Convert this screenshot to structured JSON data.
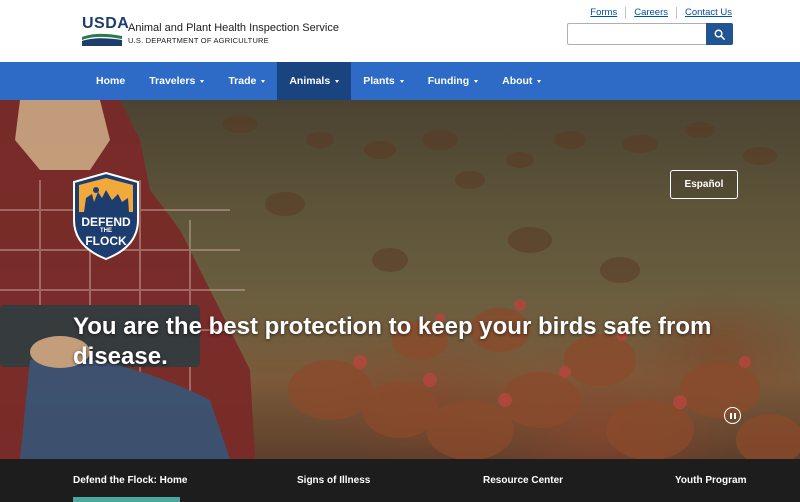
{
  "header": {
    "logo_text": "USDA",
    "agency_name": "Animal and Plant Health Inspection Service",
    "department": "U.S. DEPARTMENT OF AGRICULTURE",
    "utility_links": [
      "Forms",
      "Careers",
      "Contact Us"
    ],
    "search": {
      "placeholder": "",
      "value": "",
      "button_icon": "search-icon"
    }
  },
  "nav": {
    "items": [
      {
        "label": "Home",
        "dropdown": false
      },
      {
        "label": "Travelers",
        "dropdown": true
      },
      {
        "label": "Trade",
        "dropdown": true
      },
      {
        "label": "Animals",
        "dropdown": true,
        "active": true
      },
      {
        "label": "Plants",
        "dropdown": true
      },
      {
        "label": "Funding",
        "dropdown": true
      },
      {
        "label": "About",
        "dropdown": true
      }
    ]
  },
  "hero": {
    "badge_line1": "DEFEND",
    "badge_line2": "THE",
    "badge_line3": "FLOCK",
    "language_button": "Español",
    "headline": "You are the best protection to keep your birds safe from disease.",
    "pause_icon": "pause-icon"
  },
  "tabs": {
    "items": [
      {
        "label": "Defend the Flock: Home",
        "active": true
      },
      {
        "label": "Signs of Illness"
      },
      {
        "label": "Resource Center"
      },
      {
        "label": "Youth Program"
      }
    ]
  },
  "colors": {
    "nav_blue": "#2e6bc6",
    "nav_active": "#1a4480",
    "search_button": "#205493",
    "link_blue": "#0050a4",
    "tab_bar": "#1d1d1d",
    "tab_active_indicator": "#4aa8a0"
  }
}
